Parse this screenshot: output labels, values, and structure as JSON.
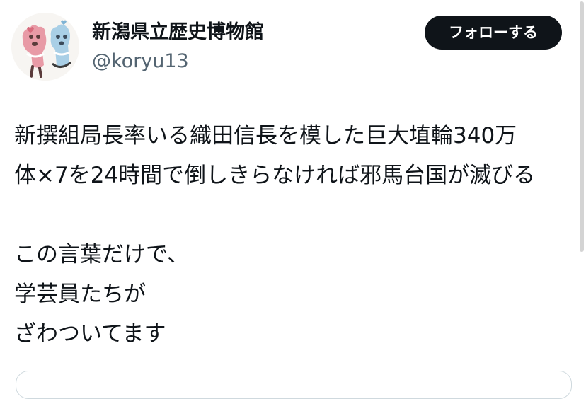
{
  "tweet": {
    "author": {
      "display_name": "新潟県立歴史博物館",
      "handle": "@koryu13",
      "avatar_icon": "haniwa-avatar-icon"
    },
    "follow_label": "フォローする",
    "lines": [
      "新撰組局長率いる織田信長を模した巨大埴輪340万",
      "体×7を24時間で倒しきらなければ邪馬台国が滅びる",
      "",
      "この言葉だけで、",
      "学芸員たちが",
      "ざわついてます"
    ]
  },
  "colors": {
    "text_primary": "#0f1419",
    "text_secondary": "#536471",
    "follow_button_bg": "#0f1419",
    "follow_button_text": "#ffffff",
    "avatar_pink": "#e89aa6",
    "avatar_blue": "#a9cfe6"
  }
}
